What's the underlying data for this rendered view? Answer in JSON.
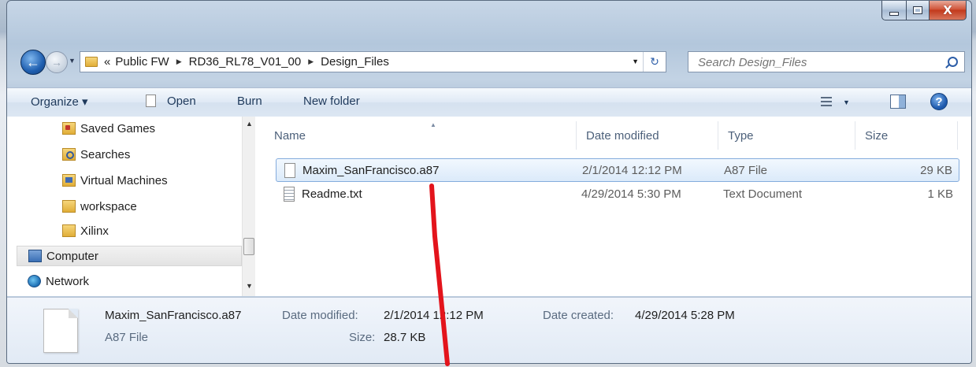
{
  "window": {
    "caption_buttons": {
      "minimize_icon": "minimize-icon",
      "maximize_icon": "maximize-icon",
      "close_glyph": "X"
    }
  },
  "address_bar": {
    "overflow_glyph": "«",
    "breadcrumbs": [
      "Public FW",
      "RD36_RL78_V01_00",
      "Design_Files"
    ],
    "separator_glyph": "▶",
    "dropdown_glyph": "▼",
    "refresh_glyph": "↻"
  },
  "search": {
    "placeholder": "Search Design_Files"
  },
  "toolbar": {
    "organize_label": "Organize ▾",
    "open_label": "Open",
    "burn_label": "Burn",
    "new_folder_label": "New folder",
    "view_dropdown_glyph": "▼",
    "help_glyph": "?"
  },
  "nav_pane": {
    "items": [
      {
        "label": "Saved Games",
        "icon": "saved-games-icon"
      },
      {
        "label": "Searches",
        "icon": "searches-icon"
      },
      {
        "label": "Virtual Machines",
        "icon": "virtual-machines-icon"
      },
      {
        "label": "workspace",
        "icon": "folder-icon"
      },
      {
        "label": "Xilinx",
        "icon": "folder-icon"
      },
      {
        "label": "Computer",
        "icon": "computer-icon",
        "selected": true
      },
      {
        "label": "Network",
        "icon": "network-icon"
      }
    ],
    "scroll_up_glyph": "▲",
    "scroll_down_glyph": "▼"
  },
  "file_list": {
    "columns": [
      "Name",
      "Date modified",
      "Type",
      "Size"
    ],
    "sort_glyph": "▲",
    "rows": [
      {
        "name": "Maxim_SanFrancisco.a87",
        "date": "2/1/2014 12:12 PM",
        "type": "A87 File",
        "size": "29 KB",
        "selected": true,
        "icon": "file-icon"
      },
      {
        "name": "Readme.txt",
        "date": "4/29/2014 5:30 PM",
        "type": "Text Document",
        "size": "1 KB",
        "selected": false,
        "icon": "text-file-icon"
      }
    ]
  },
  "details_pane": {
    "file_name": "Maxim_SanFrancisco.a87",
    "file_type": "A87 File",
    "date_modified_label": "Date modified:",
    "date_modified_value": "2/1/2014 12:12 PM",
    "size_label": "Size:",
    "size_value": "28.7 KB",
    "date_created_label": "Date created:",
    "date_created_value": "4/29/2014 5:28 PM"
  },
  "colors": {
    "accent": "#2d5ea8",
    "selection_border": "#84acdd",
    "annotation": "#e3141c"
  }
}
